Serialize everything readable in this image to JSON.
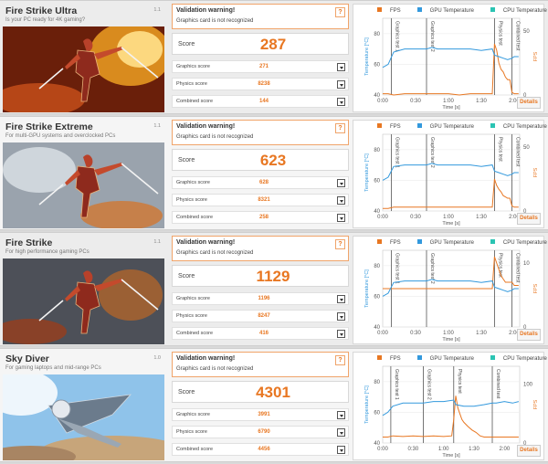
{
  "colors": {
    "fps": "#e87722",
    "gpu": "#3399dd",
    "cpu": "#2bc4b3",
    "accent": "#e87722",
    "phase": "#555555"
  },
  "labels": {
    "score": "Score",
    "graphics": "Graphics score",
    "physics": "Physics score",
    "combined": "Combined score",
    "help": "?",
    "details": "Details",
    "fps": "FPS",
    "gpu": "GPU Temperature",
    "cpu": "CPU Temperature",
    "temp_axis": "Temperature [°C]",
    "fps_axis": "FPS",
    "time_axis": "Time [s]",
    "phase_graphics1": "Graphics test 1",
    "phase_graphics2": "Graphics test 2",
    "phase_physics": "Physics test",
    "phase_combined": "Combined test"
  },
  "benchmarks": [
    {
      "name": "Fire Strike Ultra",
      "subtitle": "Is your PC ready for 4K gaming?",
      "version": "1.1",
      "warning_title": "Validation warning!",
      "warning_text": "Graphics card is not recognized",
      "score": "287",
      "graphics": "271",
      "physics": "8238",
      "combined": "144"
    },
    {
      "name": "Fire Strike Extreme",
      "subtitle": "For multi-GPU systems and overclocked PCs",
      "version": "1.1",
      "warning_title": "Validation warning!",
      "warning_text": "Graphics card is not recognized",
      "score": "623",
      "graphics": "628",
      "physics": "8321",
      "combined": "258"
    },
    {
      "name": "Fire Strike",
      "subtitle": "For high performance gaming PCs",
      "version": "1.1",
      "warning_title": "Validation warning!",
      "warning_text": "Graphics card is not recognized",
      "score": "1129",
      "graphics": "1196",
      "physics": "8247",
      "combined": "416"
    },
    {
      "name": "Sky Diver",
      "subtitle": "For gaming laptops and mid-range PCs",
      "version": "1.0",
      "warning_title": "Validation warning!",
      "warning_text": "Graphics card is not recognized",
      "score": "4301",
      "graphics": "3991",
      "physics": "6790",
      "combined": "4456"
    }
  ],
  "chart_data": [
    {
      "type": "line",
      "x_ticks": [
        "0:00",
        "0:30",
        "1:00",
        "1:30",
        "2:00"
      ],
      "xlim": [
        0,
        125
      ],
      "temp_ticks": [
        "40",
        "60",
        "80"
      ],
      "ylim_temp": [
        40,
        90
      ],
      "fps_ticks": [
        "0",
        "50"
      ],
      "ylim_fps": [
        0,
        60
      ],
      "phases": [
        8,
        40,
        102,
        118
      ],
      "series": [
        {
          "name": "FPS",
          "axis": "fps",
          "x": [
            0,
            5,
            10,
            20,
            30,
            40,
            45,
            50,
            60,
            70,
            80,
            90,
            100,
            102,
            104,
            106,
            108,
            110,
            112,
            114,
            116,
            118,
            120,
            124
          ],
          "y": [
            1,
            1,
            0,
            1,
            1,
            1,
            1,
            1,
            1,
            0,
            1,
            1,
            1,
            40,
            35,
            25,
            20,
            18,
            14,
            12,
            12,
            2,
            1,
            1
          ]
        },
        {
          "name": "GPU Temperature",
          "axis": "temp",
          "x": [
            0,
            5,
            10,
            20,
            30,
            40,
            45,
            50,
            60,
            70,
            80,
            90,
            100,
            102,
            106,
            110,
            114,
            118,
            120,
            124
          ],
          "y": [
            58,
            60,
            68,
            70,
            70,
            70,
            71,
            70,
            70,
            70,
            70,
            69,
            70,
            66,
            65,
            64,
            63,
            64,
            65,
            65
          ]
        }
      ]
    },
    {
      "type": "line",
      "x_ticks": [
        "0:00",
        "0:30",
        "1:00",
        "1:30",
        "2:00"
      ],
      "xlim": [
        0,
        125
      ],
      "temp_ticks": [
        "40",
        "60",
        "80"
      ],
      "ylim_temp": [
        40,
        90
      ],
      "fps_ticks": [
        "0",
        "50"
      ],
      "ylim_fps": [
        0,
        60
      ],
      "phases": [
        8,
        40,
        102,
        118
      ],
      "series": [
        {
          "name": "FPS",
          "axis": "fps",
          "x": [
            0,
            5,
            10,
            20,
            30,
            40,
            45,
            50,
            60,
            70,
            80,
            90,
            100,
            102,
            104,
            106,
            108,
            110,
            112,
            114,
            116,
            118,
            120,
            124
          ],
          "y": [
            2,
            2,
            3,
            3,
            3,
            3,
            3,
            3,
            3,
            3,
            3,
            3,
            3,
            25,
            20,
            17,
            15,
            12,
            11,
            10,
            10,
            4,
            3,
            3
          ]
        },
        {
          "name": "GPU Temperature",
          "axis": "temp",
          "x": [
            0,
            5,
            10,
            20,
            30,
            40,
            45,
            50,
            60,
            70,
            80,
            90,
            100,
            102,
            106,
            110,
            114,
            118,
            120,
            124
          ],
          "y": [
            60,
            62,
            69,
            70,
            70,
            70,
            71,
            70,
            70,
            70,
            70,
            69,
            70,
            66,
            65,
            64,
            63,
            64,
            65,
            65
          ]
        }
      ]
    },
    {
      "type": "line",
      "x_ticks": [
        "0:00",
        "0:30",
        "1:00",
        "1:30",
        "2:00"
      ],
      "xlim": [
        0,
        125
      ],
      "temp_ticks": [
        "40",
        "60",
        "80"
      ],
      "ylim_temp": [
        40,
        90
      ],
      "fps_ticks": [
        "0",
        "10"
      ],
      "ylim_fps": [
        0,
        12
      ],
      "phases": [
        8,
        40,
        102,
        118
      ],
      "series": [
        {
          "name": "FPS",
          "axis": "fps",
          "x": [
            0,
            5,
            10,
            20,
            30,
            40,
            45,
            50,
            60,
            70,
            80,
            90,
            100,
            102,
            104,
            106,
            108,
            110,
            112,
            114,
            116,
            118,
            120,
            124
          ],
          "y": [
            6,
            6,
            6,
            6,
            6,
            6,
            6,
            6,
            6,
            6,
            6,
            6,
            6,
            11,
            10,
            9,
            8,
            7.5,
            7,
            7,
            7,
            7,
            6.5,
            6.5
          ]
        },
        {
          "name": "GPU Temperature",
          "axis": "temp",
          "x": [
            0,
            5,
            10,
            20,
            30,
            40,
            45,
            50,
            60,
            70,
            80,
            90,
            100,
            102,
            106,
            110,
            114,
            118,
            120,
            124
          ],
          "y": [
            60,
            62,
            69,
            70,
            70,
            70,
            71,
            70,
            70,
            70,
            70,
            69,
            70,
            66,
            65,
            64,
            63,
            64,
            65,
            65
          ]
        }
      ]
    },
    {
      "type": "line",
      "x_ticks": [
        "0:00",
        "0:30",
        "1:00",
        "1:30",
        "2:00"
      ],
      "xlim": [
        0,
        135
      ],
      "temp_ticks": [
        "40",
        "60",
        "80"
      ],
      "ylim_temp": [
        40,
        90
      ],
      "fps_ticks": [
        "0",
        "100"
      ],
      "ylim_fps": [
        0,
        130
      ],
      "phases": [
        8,
        40,
        70,
        108
      ],
      "series": [
        {
          "name": "FPS",
          "axis": "fps",
          "x": [
            0,
            5,
            10,
            20,
            30,
            40,
            50,
            60,
            68,
            70,
            72,
            74,
            76,
            78,
            80,
            84,
            88,
            92,
            96,
            100,
            104,
            108,
            112,
            120,
            128,
            134
          ],
          "y": [
            10,
            10,
            12,
            11,
            12,
            11,
            12,
            11,
            12,
            40,
            80,
            60,
            50,
            40,
            35,
            28,
            22,
            18,
            12,
            10,
            10,
            10,
            10,
            10,
            10,
            10
          ]
        },
        {
          "name": "GPU Temperature",
          "axis": "temp",
          "x": [
            0,
            5,
            10,
            20,
            30,
            40,
            50,
            60,
            70,
            72,
            80,
            90,
            100,
            108,
            112,
            120,
            128,
            134
          ],
          "y": [
            58,
            60,
            64,
            66,
            66,
            66,
            67,
            67,
            68,
            65,
            64,
            64,
            65,
            66,
            66,
            67,
            66,
            67
          ]
        }
      ]
    }
  ]
}
